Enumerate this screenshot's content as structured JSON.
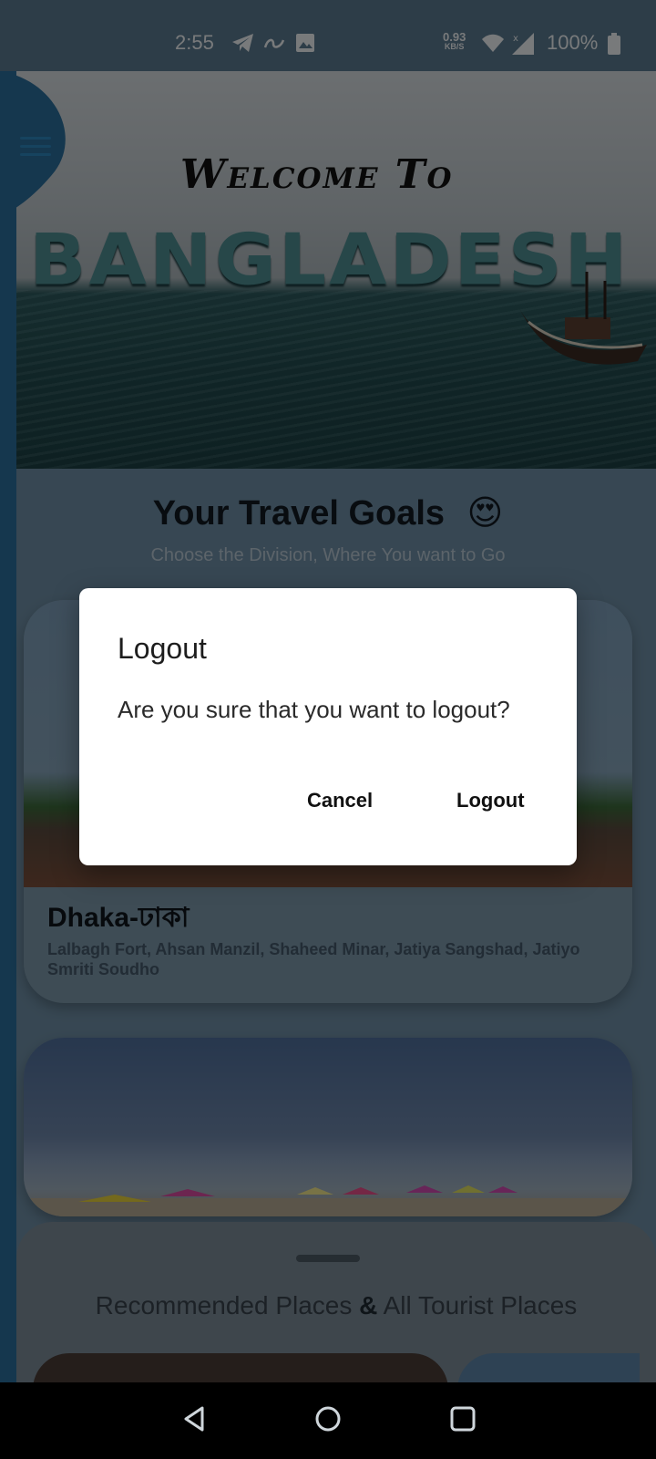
{
  "status_bar": {
    "time": "2:55",
    "net_speed_value": "0.93",
    "net_speed_unit": "KB/S",
    "battery": "100%"
  },
  "hero": {
    "welcome_text": "Welcome To",
    "country_text": "BANGLADESH"
  },
  "goals": {
    "title": "Your Travel Goals",
    "emoji": "😍",
    "subtitle": "Choose the Division, Where You want to Go"
  },
  "divisions": [
    {
      "title": "Dhaka-ঢাকা",
      "places": "Lalbagh Fort, Ahsan Manzil, Shaheed Minar, Jatiya Sangshad, Jatiyo Smriti Soudho"
    }
  ],
  "bottom_sheet": {
    "title_part1": "Recommended Places",
    "title_amp": "&",
    "title_part2": "All Tourist Places"
  },
  "dialog": {
    "title": "Logout",
    "message": "Are you sure that you want to logout?",
    "cancel_label": "Cancel",
    "confirm_label": "Logout"
  },
  "icons": {
    "menu": "menu-icon",
    "telegram": "telegram-icon",
    "link": "link-icon",
    "image": "image-icon",
    "wifi": "wifi-icon",
    "signal": "signal-icon",
    "battery": "battery-icon",
    "back": "back-icon",
    "home": "home-icon",
    "recents": "recents-icon"
  },
  "colors": {
    "accent": "#2d86bf",
    "dialog_bg": "#ffffff",
    "scrim": "rgba(0,0,0,0.5)"
  }
}
